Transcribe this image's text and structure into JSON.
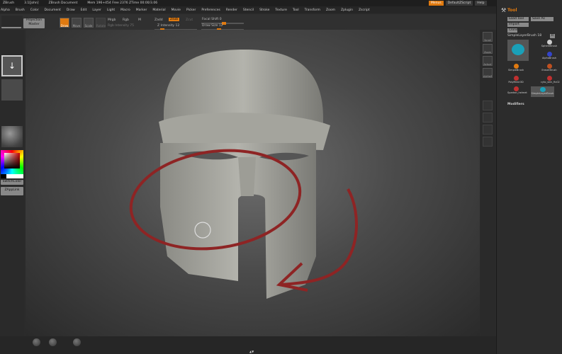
{
  "titlebar": {
    "app": "ZBrush",
    "version": "3.1[John]",
    "doc": "ZBrush Document",
    "stats": "Mem 196+454  Free 2376  ZTime 00:00/3.06"
  },
  "menu": [
    "Alpha",
    "Brush",
    "Color",
    "Document",
    "Draw",
    "Edit",
    "Layer",
    "Light",
    "Macro",
    "Marker",
    "Material",
    "Movie",
    "Picker",
    "Preferences",
    "Render",
    "Stencil",
    "Stroke",
    "Texture",
    "Tool",
    "Transform",
    "Zoom",
    "Zplugin",
    "Zscript"
  ],
  "topright": {
    "menus": "Menus",
    "script": "DefaultZScript",
    "help": "Help"
  },
  "toolbar": {
    "zmapper": "ZMapper",
    "zmapper_sub": "rev E",
    "projection": "Projection",
    "projection_sub": "Master",
    "draw": "Draw",
    "move": "Move",
    "scale": "Scale",
    "rotate": "Rotate",
    "mrgb": "Mrgb",
    "rgb": "Rgb",
    "m": "M",
    "rgb_intensity": "Rgb Intensity 75",
    "zadd": "Zadd",
    "zsub": "Zsub",
    "zcut": "Zcut",
    "z_intensity": "Z Intensity 12",
    "focal_shift": "Focal Shift 0",
    "draw_size": "Draw Size 12"
  },
  "left": {
    "switch_color": "SwitchColor",
    "zapplink": "ZAppLink"
  },
  "rshelf": [
    "Scroll",
    "Zoom",
    "Actual",
    "AAHalf"
  ],
  "tool": {
    "title": "Tool",
    "load": "Load Tool",
    "save": "Save As",
    "import": "Import",
    "clone": "Clone",
    "current": "SimpleLayerBrush 18",
    "r_btn": "R",
    "items": [
      "SphereBrush",
      "AlphaBrush",
      "SimpleBrush",
      "EraserBrush",
      "PolyMesh3D",
      "cyto_skin_fix02",
      "Spartan_helmet",
      "SimpleLayerBrush"
    ],
    "modifiers": "Modifiers"
  },
  "status": {
    "zoom": "▲▼"
  },
  "colors": {
    "accent": "#e07a10",
    "annotation": "#9a2a2a"
  }
}
